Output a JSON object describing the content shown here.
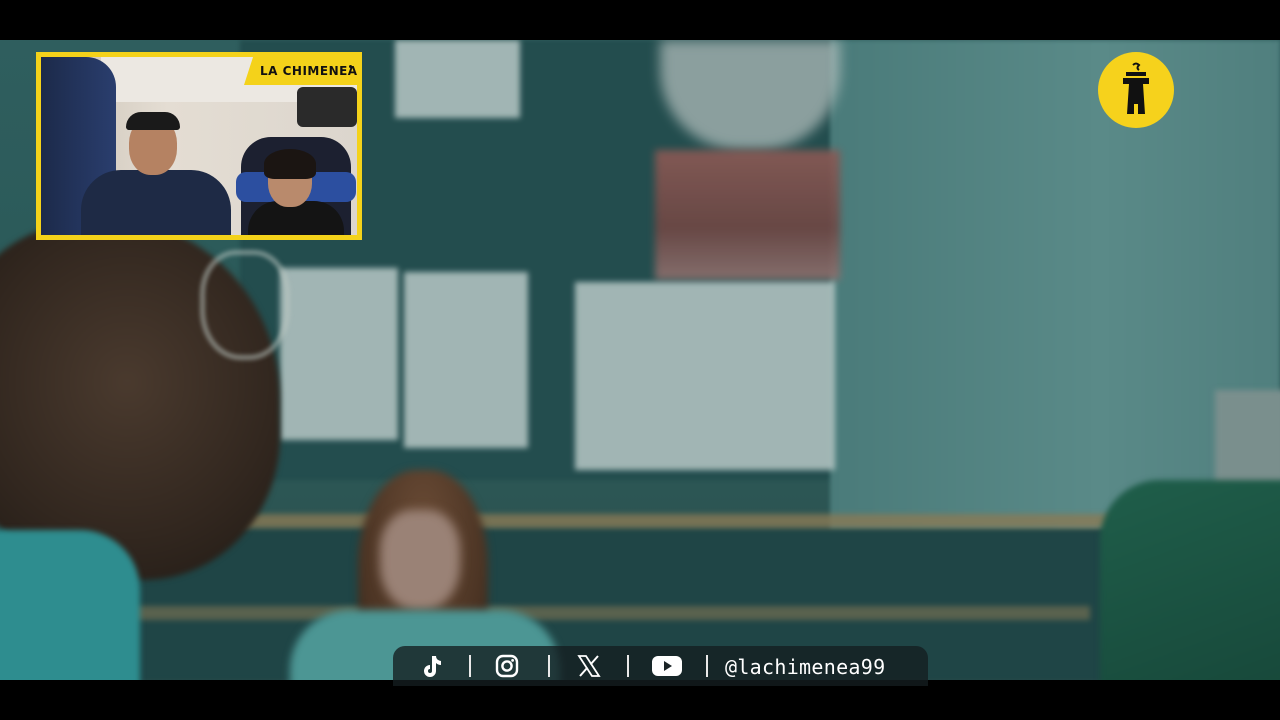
{
  "overlay": {
    "channel_label": "LA CHIMENEA",
    "accent_color": "#f4d21a"
  },
  "logo": {
    "icon": "chimney-logo-icon",
    "color": "#f6d21c"
  },
  "social_bar": {
    "icons": [
      "tiktok-icon",
      "instagram-icon",
      "x-icon",
      "youtube-icon"
    ],
    "separator": "|",
    "handle": "@lachimenea99"
  }
}
